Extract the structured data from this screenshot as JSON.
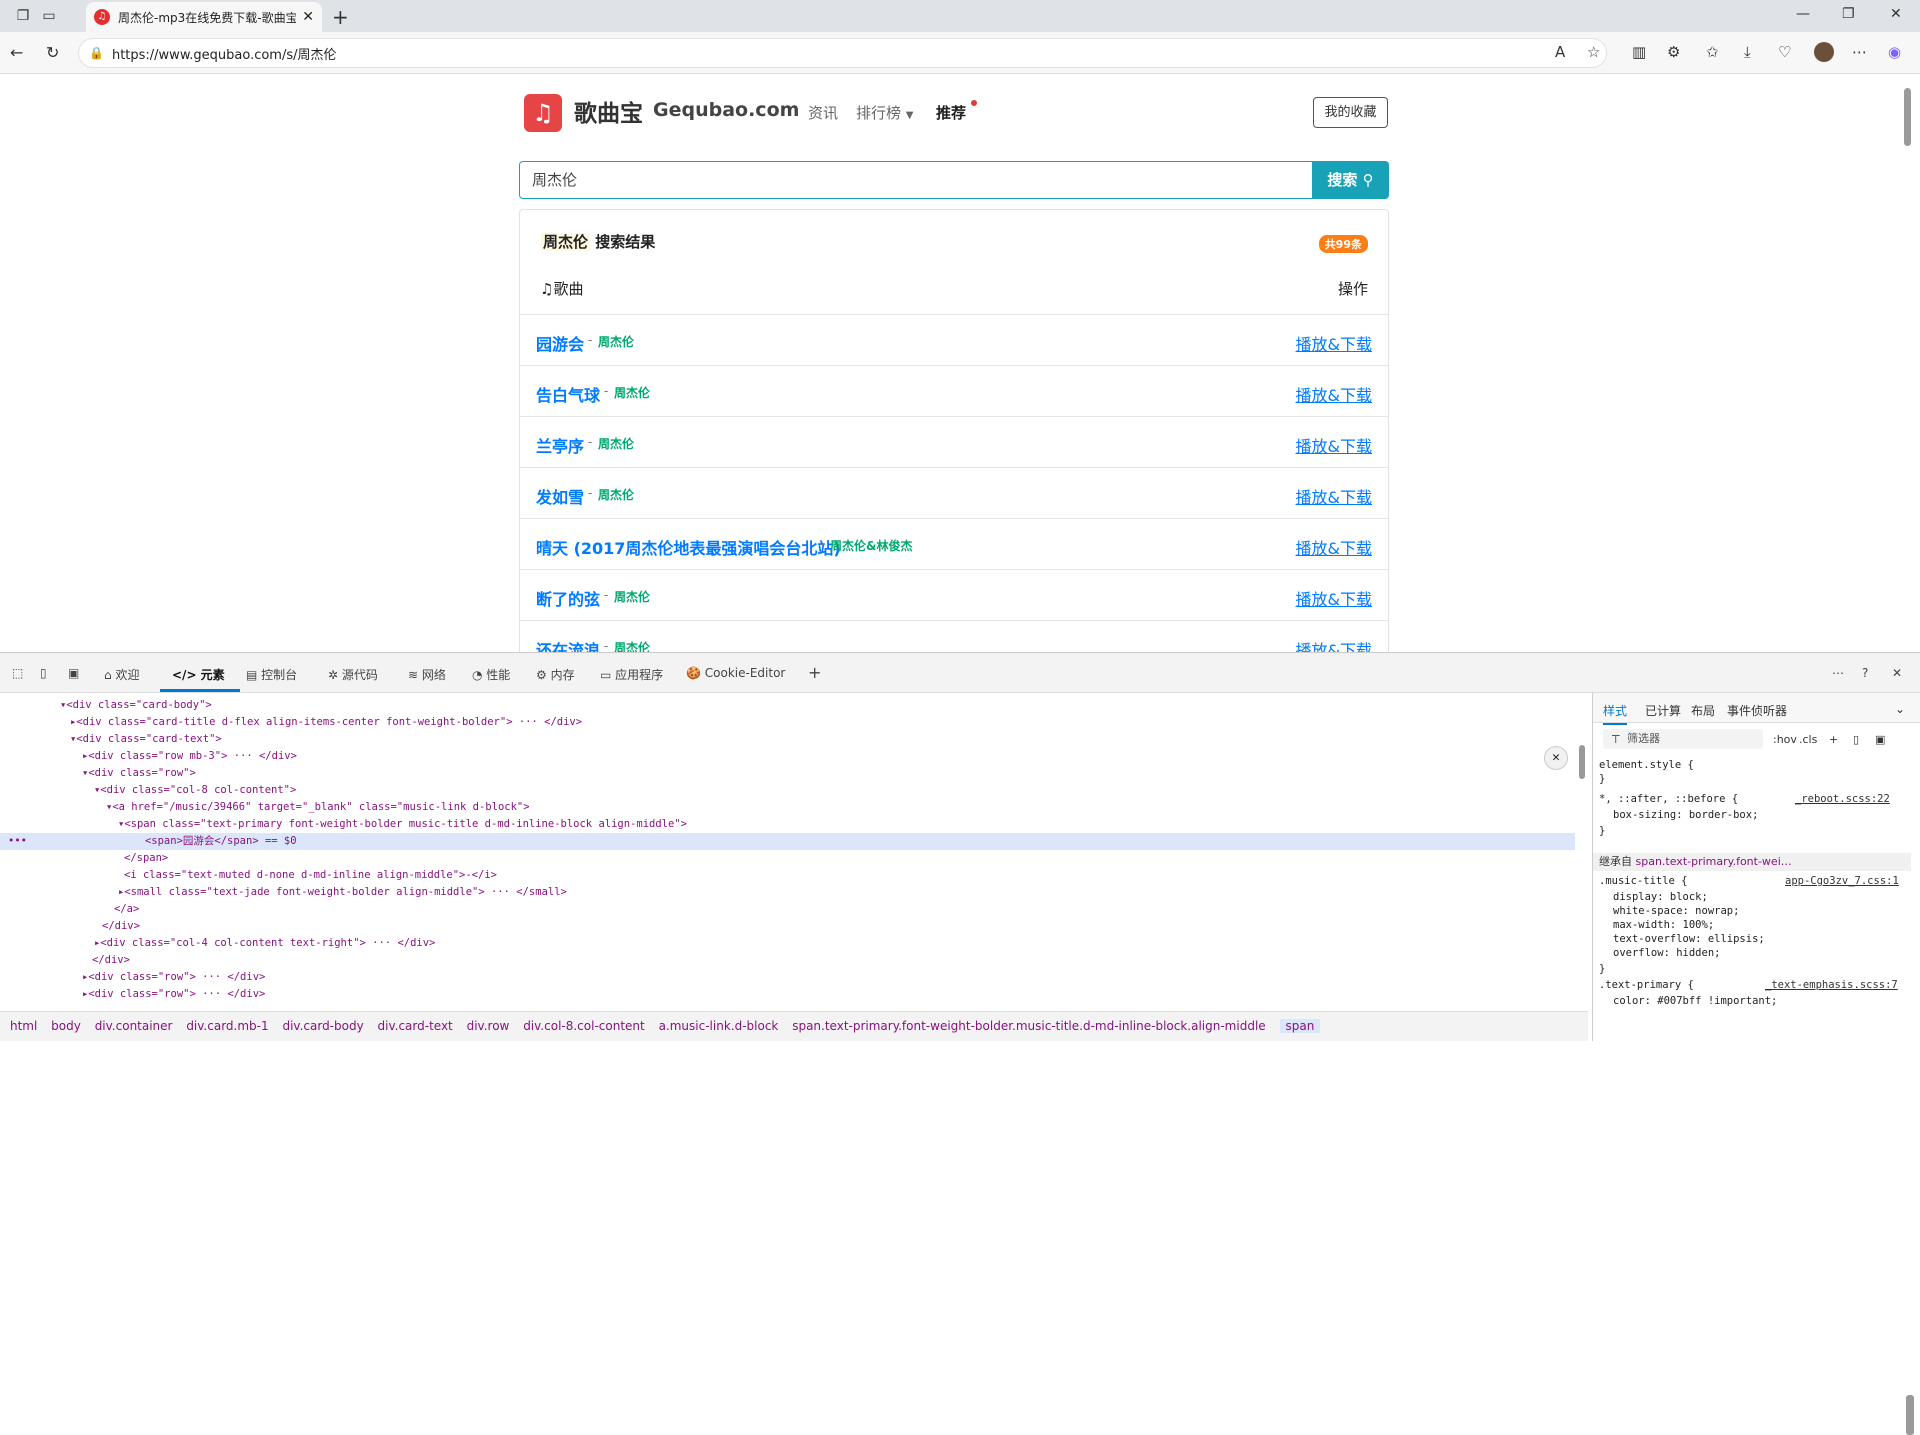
{
  "browser": {
    "tab_title": "周杰伦-mp3在线免费下载-歌曲宝",
    "url": "https://www.gequbao.com/s/周杰伦"
  },
  "site": {
    "logo_glyph": "♫",
    "brand": "歌曲宝",
    "domain": "Gequbao.com",
    "nav": [
      "资讯",
      "排行榜",
      "推荐"
    ],
    "favorites_button": "我的收藏",
    "search_value": "周杰伦",
    "search_button": "搜索"
  },
  "results": {
    "keyword": "周杰伦",
    "title_suffix": " 搜索结果",
    "count_badge": "共99条",
    "col_song": "歌曲",
    "col_action": "操作",
    "items": [
      {
        "title": "园游会",
        "artist": "周杰伦",
        "action": "播放&下载"
      },
      {
        "title": "告白气球",
        "artist": "周杰伦",
        "action": "播放&下载"
      },
      {
        "title": "兰亭序",
        "artist": "周杰伦",
        "action": "播放&下载"
      },
      {
        "title": "发如雪",
        "artist": "周杰伦",
        "action": "播放&下载"
      },
      {
        "title": "晴天 (2017周杰伦地表最强演唱会台北站)",
        "artist": "周杰伦&林俊杰",
        "action": "播放&下载"
      },
      {
        "title": "断了的弦",
        "artist": "周杰伦",
        "action": "播放&下载"
      },
      {
        "title": "还在流浪",
        "artist": "周杰伦",
        "action": "播放&下载"
      }
    ]
  },
  "devtools": {
    "tabs": [
      "欢迎",
      "元素",
      "控制台",
      "源代码",
      "网络",
      "性能",
      "内存",
      "应用程序",
      "Cookie-Editor"
    ],
    "active_tab": "元素",
    "dom_lines": [
      "<div class=\"card-body\">",
      "<div class=\"card-title d-flex align-items-center font-weight-bolder\"> ··· </div>",
      "<div class=\"card-text\">",
      "<div class=\"row mb-3\"> ··· </div>",
      "<div class=\"row\">",
      "<div class=\"col-8 col-content\">",
      "<a href=\"/music/39466\" target=\"_blank\" class=\"music-link d-block\">",
      "<span class=\"text-primary font-weight-bolder music-title d-md-inline-block align-middle\">",
      "<span>园游会</span> == $0",
      "</span>",
      "<i class=\"text-muted d-none d-md-inline align-middle\">-</i>",
      "<small class=\"text-jade font-weight-bolder align-middle\"> ··· </small>",
      "</a>",
      "</div>",
      "<div class=\"col-4 col-content text-right\"> ··· </div>",
      "</div>",
      "<div class=\"row\"> ··· </div>",
      "<div class=\"row\"> ··· </div>"
    ],
    "breadcrumb": [
      "html",
      "body",
      "div.container",
      "div.card.mb-1",
      "div.card-body",
      "div.card-text",
      "div.row",
      "div.col-8.col-content",
      "a.music-link.d-block",
      "span.text-primary.font-weight-bolder.music-title.d-md-inline-block.align-middle",
      "span"
    ],
    "styles_tabs": [
      "样式",
      "已计算",
      "布局",
      "事件侦听器"
    ],
    "filter_placeholder": "筛选器",
    "hov": ":hov",
    "cls": ".cls",
    "style_lines": [
      "element.style {",
      "}",
      "*, ::after, ::before {",
      "box-sizing: border-box;",
      "}",
      ".music-title {",
      "display: block;",
      "white-space: nowrap;",
      "max-width: 100%;",
      "text-overflow: ellipsis;",
      "overflow: hidden;",
      "}",
      ".text-primary {",
      "color: #007bff !important;"
    ],
    "style_sources": [
      "_reboot.scss:22",
      "app-Cgo3zv_7.css:1",
      "_text-emphasis.scss:7"
    ],
    "inherited_label": "继承自",
    "inherited_selector": "span.text-primary.font-wei…"
  },
  "colors": {
    "accent": "#17a2b8",
    "link": "#007bff",
    "artist": "#00a86b",
    "badge": "#fd7e14",
    "logo": "#e64545"
  }
}
